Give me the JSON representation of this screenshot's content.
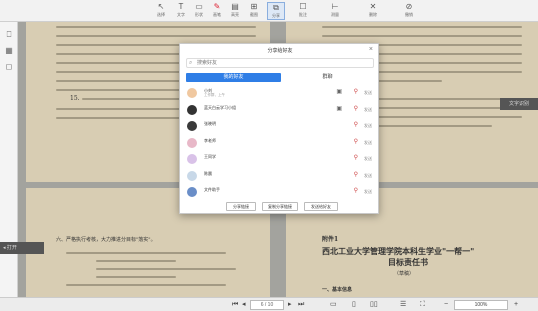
{
  "toolbar": {
    "items": [
      {
        "icon": "pointer-icon",
        "label": "选择"
      },
      {
        "icon": "text-icon",
        "label": "文字"
      },
      {
        "icon": "rect-icon",
        "label": "形状"
      },
      {
        "icon": "pen-icon",
        "label": "画笔"
      },
      {
        "icon": "highlight-icon",
        "label": "高亮"
      },
      {
        "icon": "grid-icon",
        "label": "截图"
      },
      {
        "icon": "screenshot-icon",
        "label": "分享"
      },
      {
        "icon": "note-icon",
        "label": "批注"
      },
      {
        "icon": "ruler-icon",
        "label": "测量"
      },
      {
        "icon": "close-x-icon",
        "label": "删除"
      },
      {
        "icon": "ban-icon",
        "label": "撤销"
      }
    ]
  },
  "dialog": {
    "title": "分享给好友",
    "close": "×",
    "search_placeholder": "搜索好友",
    "tabs": [
      "我的好友",
      "群聊"
    ],
    "contacts": [
      {
        "name": "小刘",
        "sub": "工作群，上午",
        "color": "#f0c8a0"
      },
      {
        "name": "蓝天白云学习小组",
        "sub": "",
        "color": "#333333"
      },
      {
        "name": "张晓明",
        "sub": "",
        "color": "#3a3a3a"
      },
      {
        "name": "李老师",
        "sub": "",
        "color": "#e8b8c8"
      },
      {
        "name": "王同学",
        "sub": "",
        "color": "#d9c2e8"
      },
      {
        "name": "陈晨",
        "sub": "",
        "color": "#c8d8e8"
      },
      {
        "name": "文件助手",
        "sub": "",
        "color": "#6a8ec8"
      }
    ],
    "action_label": "发送",
    "buttons": [
      "分享链接",
      "复制分享链接",
      "发送给好友"
    ]
  },
  "document": {
    "para_15": "15.",
    "section_heading": "六、严格执行考核，大力推进分目标\"落实\"。",
    "appendix_label": "附件1",
    "appendix_title_1": "西北工业大学管理学院本科生学业\"一帮一\"",
    "appendix_title_2": "目标责任书",
    "appendix_subtitle": "（草稿）",
    "section_one": "一、基本信息"
  },
  "side_indicators": {
    "right": "文字识别",
    "left": "打开"
  },
  "bottombar": {
    "page": "6 / 10",
    "zoom": "100%"
  }
}
